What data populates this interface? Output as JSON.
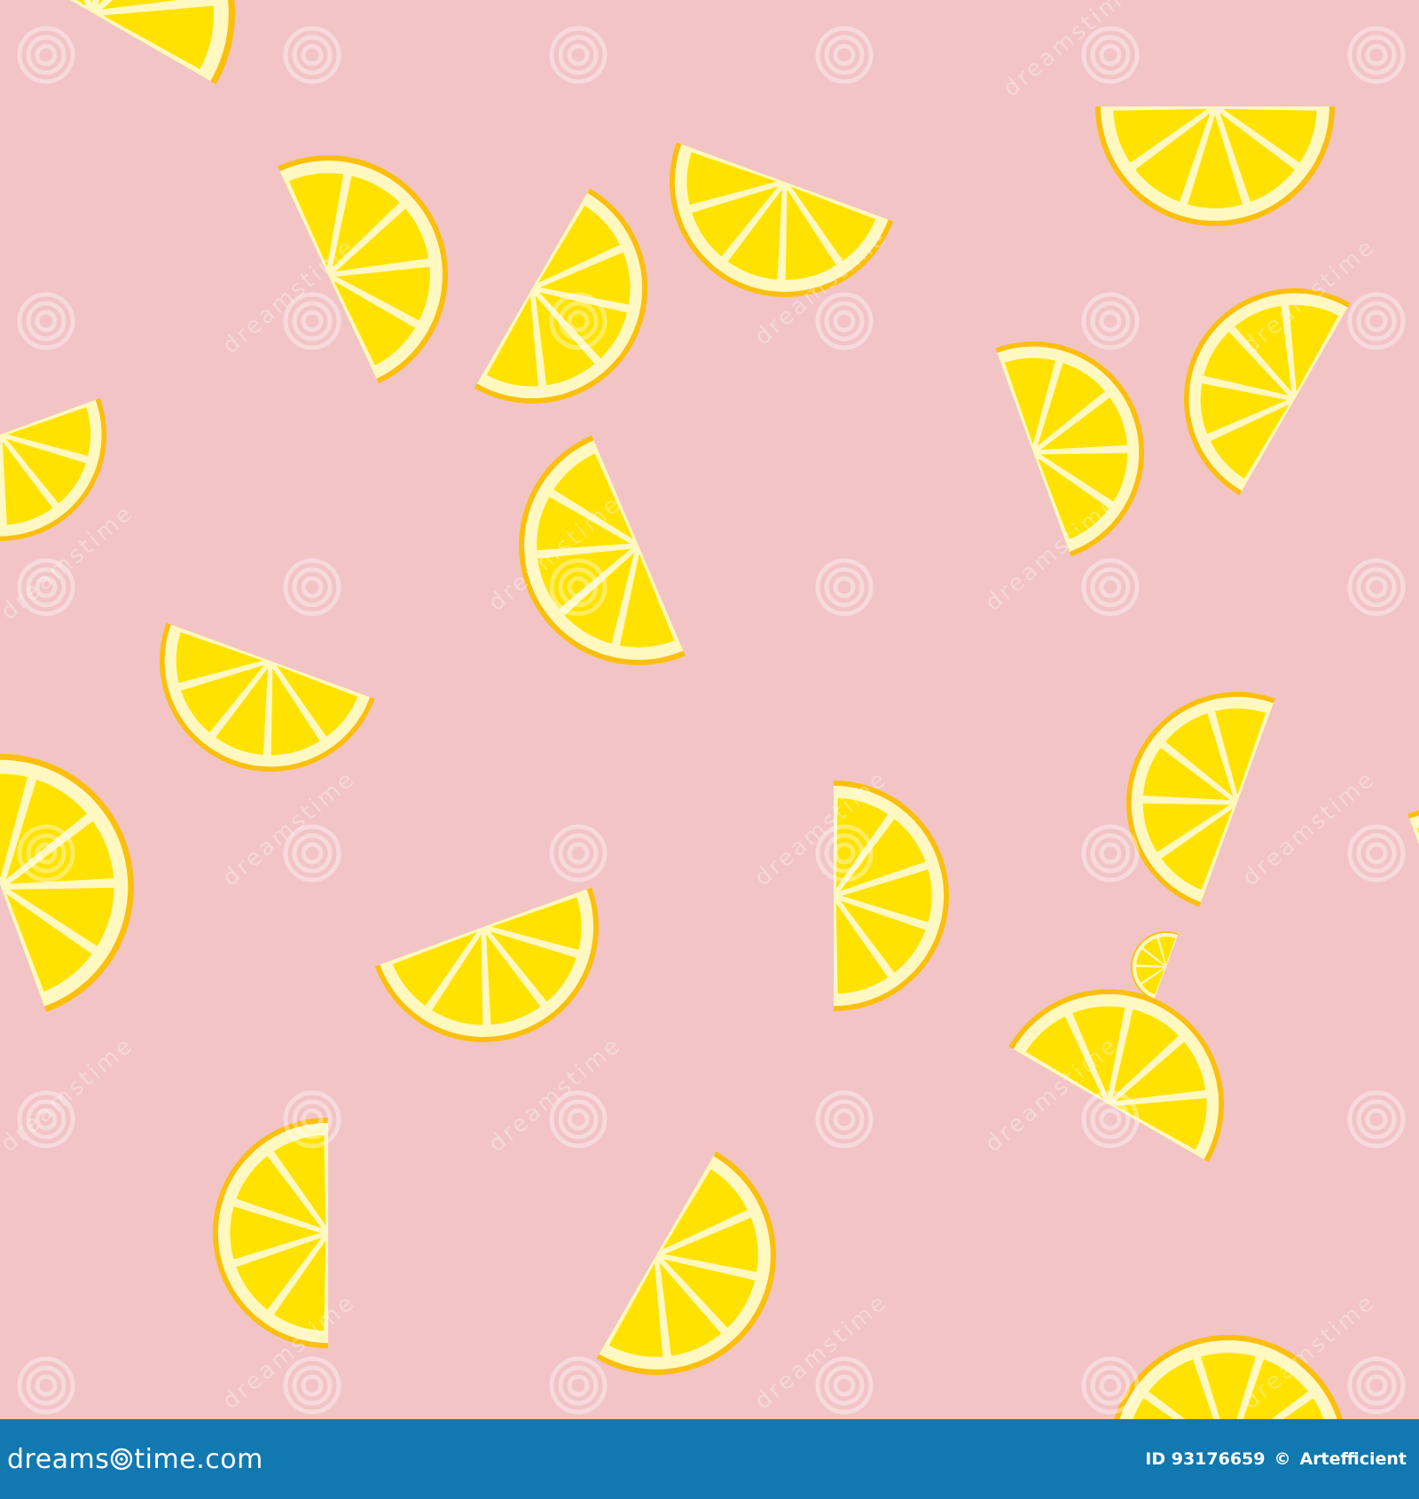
{
  "image": {
    "background_color": "#f2c4c6",
    "lemon_colors": {
      "rind": "#fbbf0c",
      "pith": "#fff8c0",
      "flesh": "#ffe200"
    },
    "watermark": {
      "text": "dreamstime",
      "icon": "dreamstime-spiral-icon"
    }
  },
  "footer": {
    "bar_color": "#1178b0",
    "logo_prefix": "dreams",
    "logo_suffix": "time.com",
    "stock_id": "ID 93176659",
    "copyright_symbol": "©",
    "author": "Artefficient"
  }
}
